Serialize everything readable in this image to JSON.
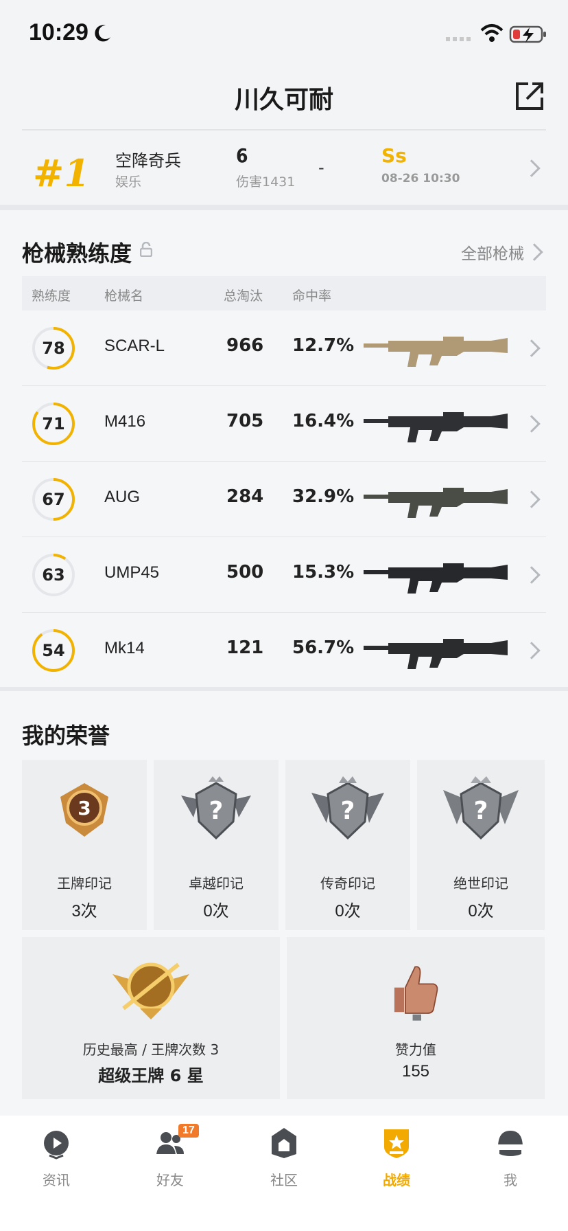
{
  "status_bar": {
    "time": "10:29"
  },
  "header": {
    "title": "川久可耐"
  },
  "match": {
    "rank": "#1",
    "mode": "空降奇兵",
    "type": "娱乐",
    "kills": "6",
    "damage": "伤害1431",
    "dash": "-",
    "grade": "Ss",
    "time": "08-26 10:30"
  },
  "weapons": {
    "title": "枪械熟练度",
    "all_link": "全部枪械",
    "headers": {
      "mastery": "熟练度",
      "name": "枪械名",
      "kills": "总淘汰",
      "accuracy": "命中率"
    },
    "rows": [
      {
        "mastery": "78",
        "progress": 0.55,
        "name": "SCAR-L",
        "kills": "966",
        "accuracy": "12.7%",
        "color": "#b09a76"
      },
      {
        "mastery": "71",
        "progress": 0.85,
        "name": "M416",
        "kills": "705",
        "accuracy": "16.4%",
        "color": "#2e3033"
      },
      {
        "mastery": "67",
        "progress": 0.5,
        "name": "AUG",
        "kills": "284",
        "accuracy": "32.9%",
        "color": "#4a4d45"
      },
      {
        "mastery": "63",
        "progress": 0.1,
        "name": "UMP45",
        "kills": "500",
        "accuracy": "15.3%",
        "color": "#26282b"
      },
      {
        "mastery": "54",
        "progress": 0.9,
        "name": "Mk14",
        "kills": "121",
        "accuracy": "56.7%",
        "color": "#2a2c2e"
      }
    ]
  },
  "honors": {
    "title": "我的荣誉",
    "cards": [
      {
        "label": "王牌印记",
        "count": "3次",
        "emblem_text": "3"
      },
      {
        "label": "卓越印记",
        "count": "0次",
        "emblem_text": "?"
      },
      {
        "label": "传奇印记",
        "count": "0次",
        "emblem_text": "?"
      },
      {
        "label": "绝世印记",
        "count": "0次",
        "emblem_text": "?"
      }
    ],
    "highest": {
      "label": "历史最高 / 王牌次数 3",
      "value": "超级王牌 6 星"
    },
    "likes": {
      "label": "赞力值",
      "value": "155"
    }
  },
  "nav": {
    "items": [
      {
        "label": "资讯",
        "icon": "news-icon"
      },
      {
        "label": "好友",
        "icon": "friends-icon",
        "badge": "17"
      },
      {
        "label": "社区",
        "icon": "community-icon"
      },
      {
        "label": "战绩",
        "icon": "record-icon",
        "active": true
      },
      {
        "label": "我",
        "icon": "me-icon"
      }
    ]
  },
  "colors": {
    "accent": "#f2b200",
    "ring_track": "#e4e6ea",
    "nav_active": "#f2a900"
  }
}
